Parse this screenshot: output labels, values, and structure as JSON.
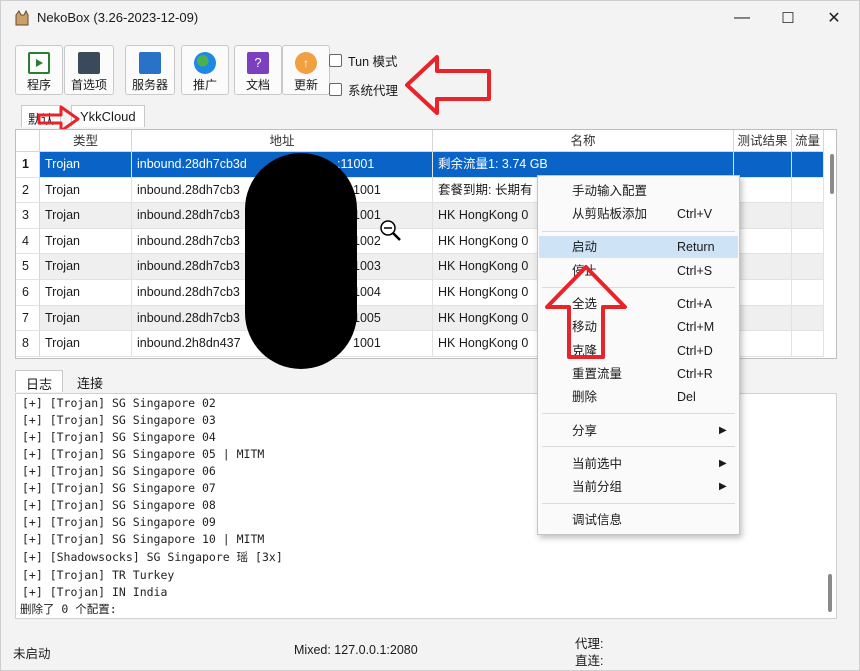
{
  "window": {
    "title": "NekoBox (3.26-2023-12-09)",
    "controls": {
      "minimize": "—",
      "maximize": "☐",
      "close": "✕"
    }
  },
  "toolbar": {
    "buttons": [
      {
        "label": "程序",
        "icon": "program-icon",
        "color": "#2e7d32"
      },
      {
        "label": "首选项",
        "icon": "preferences-icon",
        "color": "#3a4a5a"
      },
      {
        "label": "服务器",
        "icon": "server-icon",
        "color": "#2a72c8"
      },
      {
        "label": "推广",
        "icon": "globe-icon",
        "color": "#1e88e5"
      },
      {
        "label": "文档",
        "icon": "document-icon",
        "color": "#7b3fbf"
      },
      {
        "label": "更新",
        "icon": "update-icon",
        "color": "#f0a040"
      }
    ],
    "tun_mode": "Tun 模式",
    "system_proxy": "系统代理"
  },
  "groups": {
    "tabs": [
      "默认",
      "YkkCloud"
    ],
    "active": "YkkCloud"
  },
  "table": {
    "columns": [
      "类型",
      "地址",
      "名称",
      "测试结果",
      "流量"
    ],
    "rows": [
      {
        "num": "1",
        "type": "Trojan",
        "addr": "inbound.28dh7cb3d",
        "addr_tail": ":11001",
        "name": "剩余流量1: 3.74 GB",
        "selected": true
      },
      {
        "num": "2",
        "type": "Trojan",
        "addr": "inbound.28dh7cb3",
        "addr_tail": "1001",
        "name": "套餐到期: 长期有"
      },
      {
        "num": "3",
        "type": "Trojan",
        "addr": "inbound.28dh7cb3",
        "addr_tail": "1001",
        "name": "HK HongKong 0"
      },
      {
        "num": "4",
        "type": "Trojan",
        "addr": "inbound.28dh7cb3",
        "addr_tail": "1002",
        "name": "HK HongKong 0"
      },
      {
        "num": "5",
        "type": "Trojan",
        "addr": "inbound.28dh7cb3",
        "addr_tail": "1003",
        "name": "HK HongKong 0"
      },
      {
        "num": "6",
        "type": "Trojan",
        "addr": "inbound.28dh7cb3",
        "addr_tail": "1004",
        "name": "HK HongKong 0"
      },
      {
        "num": "7",
        "type": "Trojan",
        "addr": "inbound.28dh7cb3",
        "addr_tail": "1005",
        "name": "HK HongKong 0"
      },
      {
        "num": "8",
        "type": "Trojan",
        "addr": "inbound.2h8dn437",
        "addr_tail": "1001",
        "name": "HK HongKong 0"
      }
    ]
  },
  "bottom_tabs": {
    "tabs": [
      "日志",
      "连接"
    ],
    "active": "日志"
  },
  "log": {
    "lines": [
      "[+] [Trojan] SG Singapore 02",
      "[+] [Trojan] SG Singapore 03",
      "[+] [Trojan] SG Singapore 04",
      "[+] [Trojan] SG Singapore 05 | MITM",
      "[+] [Trojan] SG Singapore 06",
      "[+] [Trojan] SG Singapore 07",
      "[+] [Trojan] SG Singapore 08",
      "[+] [Trojan] SG Singapore 09",
      "[+] [Trojan] SG Singapore 10 | MITM",
      "[+] [Shadowsocks] SG Singapore 瑶 [3x]",
      "[+] [Trojan] TR Turkey",
      "[+] [Trojan] IN India",
      "删除了 0 个配置:"
    ]
  },
  "status": {
    "left": "未启动",
    "mixed": "Mixed: 127.0.0.1:2080",
    "proxy": "代理:",
    "direct": "直连:"
  },
  "context_menu": {
    "items": [
      {
        "label": "手动输入配置",
        "shortcut": ""
      },
      {
        "label": "从剪贴板添加",
        "shortcut": "Ctrl+V"
      },
      {
        "label": "启动",
        "shortcut": "Return",
        "highlighted": true
      },
      {
        "label": "停止",
        "shortcut": "Ctrl+S"
      },
      {
        "label": "全选",
        "shortcut": "Ctrl+A"
      },
      {
        "label": "移动",
        "shortcut": "Ctrl+M"
      },
      {
        "label": "克隆",
        "shortcut": "Ctrl+D"
      },
      {
        "label": "重置流量",
        "shortcut": "Ctrl+R"
      },
      {
        "label": "删除",
        "shortcut": "Del"
      },
      {
        "label": "分享",
        "submenu": true
      },
      {
        "label": "当前选中",
        "submenu": true
      },
      {
        "label": "当前分组",
        "submenu": true
      },
      {
        "label": "调试信息",
        "shortcut": ""
      }
    ]
  },
  "annotations": {
    "arrow_color": "#e8232a"
  }
}
